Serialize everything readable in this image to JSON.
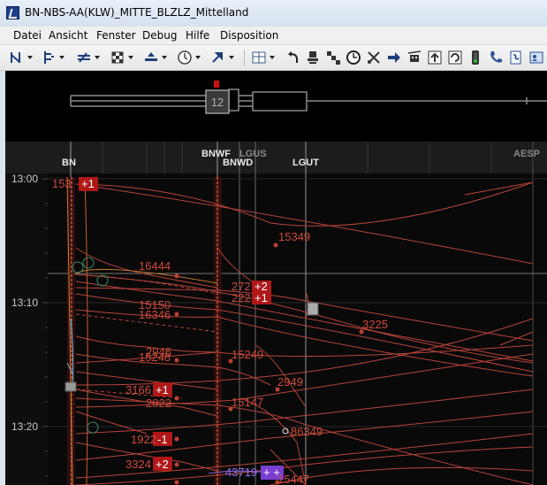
{
  "window": {
    "title": "BN-NBS-AA(KLW)_MITTE_BLZLZ_Mittelland"
  },
  "menu": {
    "items": [
      "Datei",
      "Ansicht",
      "Fenster",
      "Debug",
      "Hilfe",
      "Disposition"
    ]
  },
  "toolbar": {
    "icons": [
      "route-icon",
      "signal-icon",
      "track-icon",
      "grid-icon",
      "platform-icon",
      "clock-dial-icon",
      "arrow-icon",
      "table-icon",
      "undo-arrow-icon",
      "stamp-icon",
      "steps-icon",
      "clock-icon",
      "scissors-icon",
      "arrow-right-icon",
      "cable-car-icon",
      "upload-icon",
      "refresh-icon",
      "traffic-light-icon",
      "phone-icon",
      "phone-book-icon",
      "contact-card-icon"
    ]
  },
  "track": {
    "block_number": "12"
  },
  "stations": {
    "bn": "BN",
    "bnwf": "BNWF",
    "lgus": "LGUS",
    "bnwd": "BNWD",
    "lgut": "LGUT",
    "aesp": "AESP"
  },
  "times": {
    "t1300": "13:00",
    "t1310": "13:10",
    "t1320": "13:20"
  },
  "trains": {
    "t15349": "15349",
    "t16444": "16444",
    "t15150": "15150",
    "t16346": "16346",
    "t3225": "3225",
    "t2946": "2946",
    "t15248": "15248",
    "t15249": "15249",
    "t2949": "2949",
    "t2022": "2022",
    "t15147": "15147",
    "t86349": "86349",
    "t43719": "43719",
    "t15447": "15447",
    "t153": "153",
    "t3166": "3166",
    "t1922": "1922",
    "t3324": "3324",
    "t272": "272",
    "t222": "222"
  },
  "delays": {
    "d153": "+1",
    "d272": "+2",
    "d222": "+1",
    "d3166": "+1",
    "d1922": "-1",
    "d3324": "+2",
    "d43719": "+ +"
  },
  "colors": {
    "train": "#b8443a",
    "label": "#d04a3c",
    "badge": "#b01818",
    "badge_purple": "#7a3ed1",
    "grid": "#2c2c2c",
    "station_line": "#8a8a8a",
    "accent": "#e0a020"
  }
}
